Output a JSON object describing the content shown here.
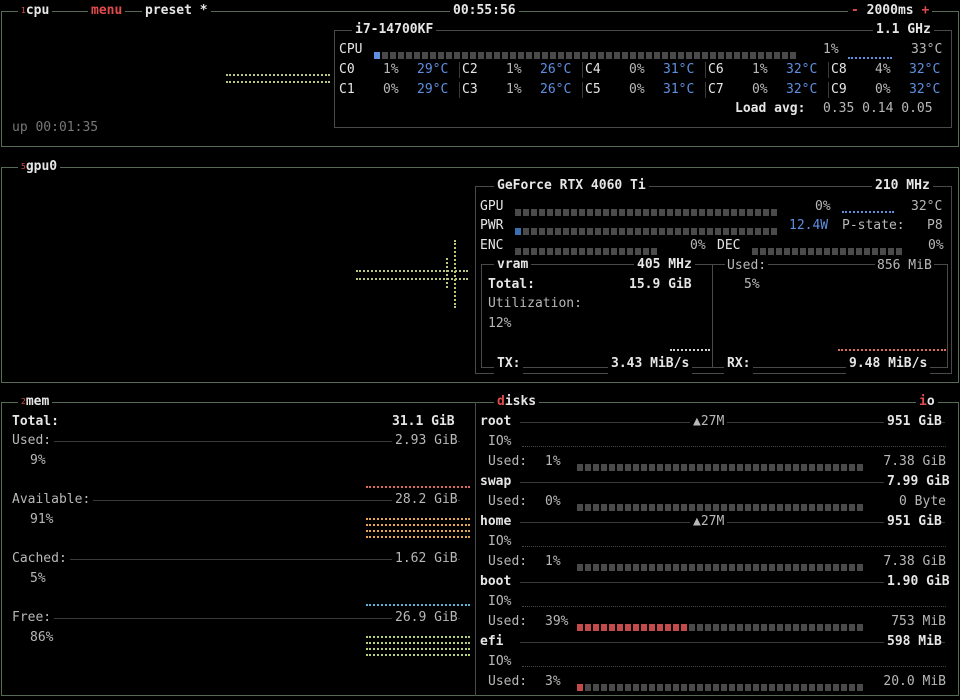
{
  "header": {
    "cpu_tab": "cpu",
    "cpu_num": "1",
    "menu_tab": "menu",
    "preset_tab": "preset *",
    "clock": "00:55:56",
    "minus": "-",
    "interval": "2000ms",
    "plus": "+"
  },
  "cpu": {
    "model": "i7-14700KF",
    "freq": "1.1 GHz",
    "total_label": "CPU",
    "total_pct": "1%",
    "total_pct_value": 1,
    "total_temp": "33°C",
    "uptime": "up 00:01:35",
    "load_label": "Load avg:",
    "load": "0.35 0.14 0.05",
    "cores": [
      {
        "name": "C0",
        "pct": "1%",
        "temp": "29°C"
      },
      {
        "name": "C1",
        "pct": "0%",
        "temp": "29°C"
      },
      {
        "name": "C2",
        "pct": "1%",
        "temp": "26°C"
      },
      {
        "name": "C3",
        "pct": "1%",
        "temp": "26°C"
      },
      {
        "name": "C4",
        "pct": "0%",
        "temp": "31°C"
      },
      {
        "name": "C5",
        "pct": "0%",
        "temp": "31°C"
      },
      {
        "name": "C6",
        "pct": "1%",
        "temp": "32°C"
      },
      {
        "name": "C7",
        "pct": "0%",
        "temp": "32°C"
      },
      {
        "name": "C8",
        "pct": "4%",
        "temp": "32°C"
      },
      {
        "name": "C9",
        "pct": "0%",
        "temp": "32°C"
      }
    ]
  },
  "gpu": {
    "tab": "gpu0",
    "num": "5",
    "model": "GeForce RTX 4060 Ti",
    "clock": "210 MHz",
    "gpu_label": "GPU",
    "gpu_pct": "0%",
    "gpu_pct_value": 0,
    "gpu_temp": "32°C",
    "pwr_label": "PWR",
    "pwr_value": "12.4W",
    "pstate_label": "P-state:",
    "pstate": "P8",
    "enc_label": "ENC",
    "enc_pct": "0%",
    "dec_label": "DEC",
    "dec_pct": "0%",
    "vram_label": "vram",
    "vram_clock": "405 MHz",
    "total_label": "Total:",
    "total": "15.9 GiB",
    "used_label": "Used:",
    "used": "856 MiB",
    "used_pct": "5%",
    "util_label": "Utilization:",
    "util_pct": "12%",
    "tx_label": "TX:",
    "tx": "3.43 MiB/s",
    "rx_label": "RX:",
    "rx": "9.48 MiB/s"
  },
  "mem": {
    "tab": "mem",
    "num": "2",
    "total_label": "Total:",
    "total": "31.1 GiB",
    "items": [
      {
        "label": "Used:",
        "value": "2.93 GiB",
        "pct": "9%",
        "color": "#e06a5a"
      },
      {
        "label": "Available:",
        "value": "28.2 GiB",
        "pct": "91%",
        "color": "#e8a64a"
      },
      {
        "label": "Cached:",
        "value": "1.62 GiB",
        "pct": "5%",
        "color": "#5ab4d8"
      },
      {
        "label": "Free:",
        "value": "26.9 GiB",
        "pct": "86%",
        "color": "#b8d27a"
      }
    ]
  },
  "disks": {
    "tab_first": "d",
    "tab_rest": "isks",
    "io_first": "i",
    "io_rest": "o",
    "io_label": "IO%",
    "used_label": "Used:",
    "items": [
      {
        "name": "root",
        "io": "▲27M",
        "size": "951 GiB",
        "used_pct": "1%",
        "used_value": 1,
        "used": "7.38 GiB",
        "has_io": true
      },
      {
        "name": "swap",
        "io": "",
        "size": "7.99 GiB",
        "used_pct": "0%",
        "used_value": 0,
        "used": "0 Byte",
        "has_io": false
      },
      {
        "name": "home",
        "io": "▲27M",
        "size": "951 GiB",
        "used_pct": "1%",
        "used_value": 1,
        "used": "7.38 GiB",
        "has_io": true
      },
      {
        "name": "boot",
        "io": "",
        "size": "1.90 GiB",
        "used_pct": "39%",
        "used_value": 39,
        "used": "753 MiB",
        "has_io": true
      },
      {
        "name": "efi",
        "io": "",
        "size": "598 MiB",
        "used_pct": "3%",
        "used_value": 3,
        "used": "20.0 MiB",
        "has_io": true
      }
    ]
  }
}
